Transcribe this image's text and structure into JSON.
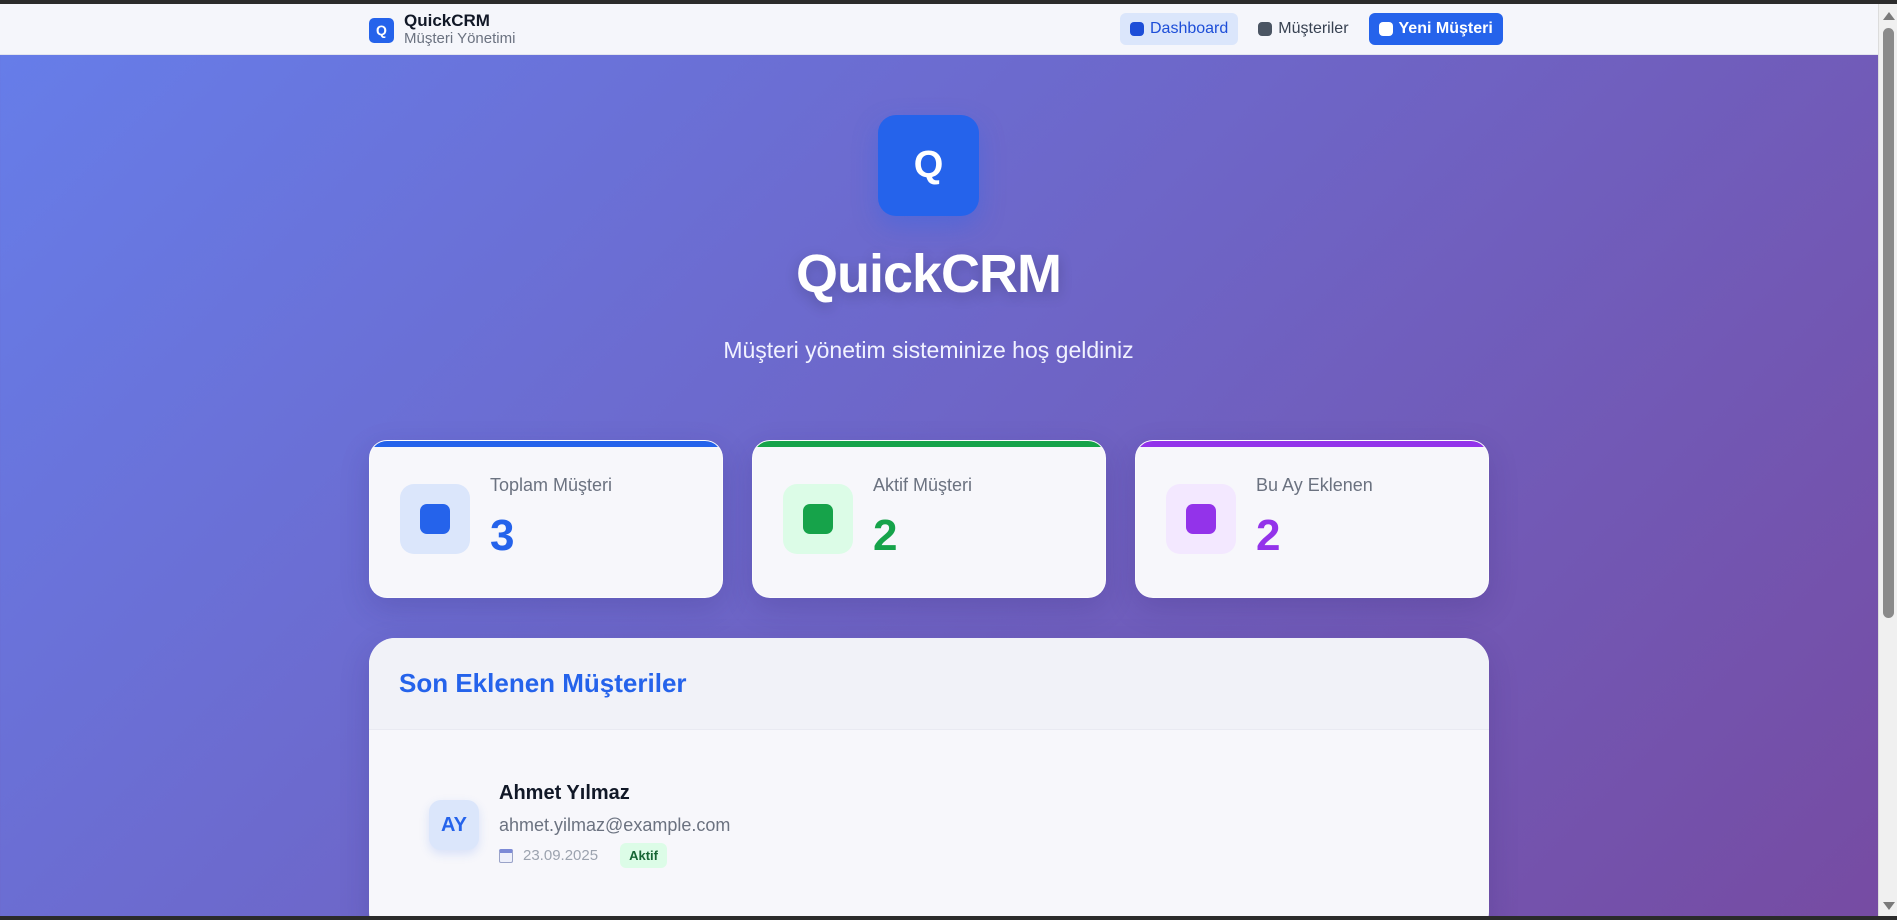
{
  "navbar": {
    "logo_letter": "Q",
    "title": "QuickCRM",
    "subtitle": "Müşteri Yönetimi",
    "links": [
      {
        "label": "Dashboard",
        "icon": "dashboard-icon"
      },
      {
        "label": "Müşteriler",
        "icon": "customers-icon"
      },
      {
        "label": "Yeni Müşteri",
        "icon": "add-customer-icon"
      }
    ]
  },
  "hero": {
    "logo_letter": "Q",
    "title": "QuickCRM",
    "subtitle": "Müşteri yönetim sisteminize hoş geldiniz"
  },
  "stats": [
    {
      "label": "Toplam Müşteri",
      "value": "3",
      "color": "#2563eb",
      "bg": "#dbe6fb"
    },
    {
      "label": "Aktif Müşteri",
      "value": "2",
      "color": "#16a34a",
      "bg": "#dcfce7"
    },
    {
      "label": "Bu Ay Eklenen",
      "value": "2",
      "color": "#9333ea",
      "bg": "#f3e8ff"
    }
  ],
  "recent": {
    "title": "Son Eklenen Müşteriler",
    "customers": [
      {
        "initials": "AY",
        "name": "Ahmet Yılmaz",
        "email": "ahmet.yilmaz@example.com",
        "date": "23.09.2025",
        "status": "Aktif"
      }
    ]
  }
}
